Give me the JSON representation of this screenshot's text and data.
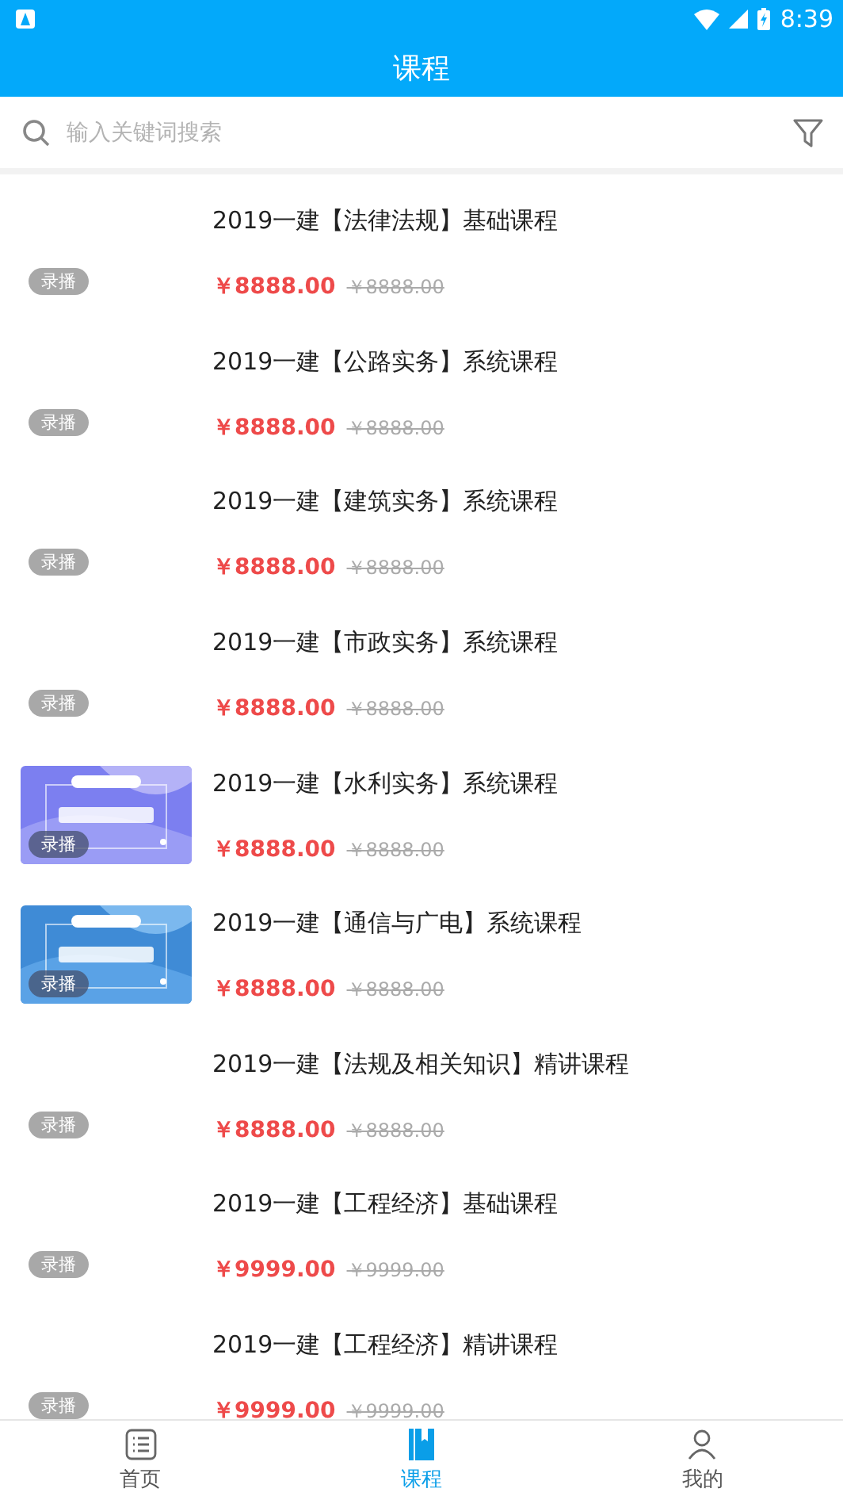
{
  "status_bar": {
    "time": "8:39"
  },
  "header": {
    "title": "课程"
  },
  "search": {
    "placeholder": "输入关键词搜索"
  },
  "courses": [
    {
      "title": "2019一建【法律法规】基础课程",
      "price": "￥8888.00",
      "original_price": "￥8888.00",
      "badge": "录播",
      "kind": "plain"
    },
    {
      "title": "2019一建【公路实务】系统课程",
      "price": "￥8888.00",
      "original_price": "￥8888.00",
      "badge": "录播",
      "kind": "plain"
    },
    {
      "title": "2019一建【建筑实务】系统课程",
      "price": "￥8888.00",
      "original_price": "￥8888.00",
      "badge": "录播",
      "kind": "plain"
    },
    {
      "title": "2019一建【市政实务】系统课程",
      "price": "￥8888.00",
      "original_price": "￥8888.00",
      "badge": "录播",
      "kind": "plain"
    },
    {
      "title": "2019一建【水利实务】系统课程",
      "price": "￥8888.00",
      "original_price": "￥8888.00",
      "badge": "录播",
      "kind": "picture"
    },
    {
      "title": "2019一建【通信与广电】系统课程",
      "price": "￥8888.00",
      "original_price": "￥8888.00",
      "badge": "录播",
      "kind": "picture"
    },
    {
      "title": "2019一建【法规及相关知识】精讲课程",
      "price": "￥8888.00",
      "original_price": "￥8888.00",
      "badge": "录播",
      "kind": "plain"
    },
    {
      "title": "2019一建【工程经济】基础课程",
      "price": "￥9999.00",
      "original_price": "￥9999.00",
      "badge": "录播",
      "kind": "plain"
    },
    {
      "title": "2019一建【工程经济】精讲课程",
      "price": "￥9999.00",
      "original_price": "￥9999.00",
      "badge": "录播",
      "kind": "plain"
    }
  ],
  "tabs": [
    {
      "label": "首页",
      "selected": false
    },
    {
      "label": "课程",
      "selected": true
    },
    {
      "label": "我的",
      "selected": false
    }
  ]
}
